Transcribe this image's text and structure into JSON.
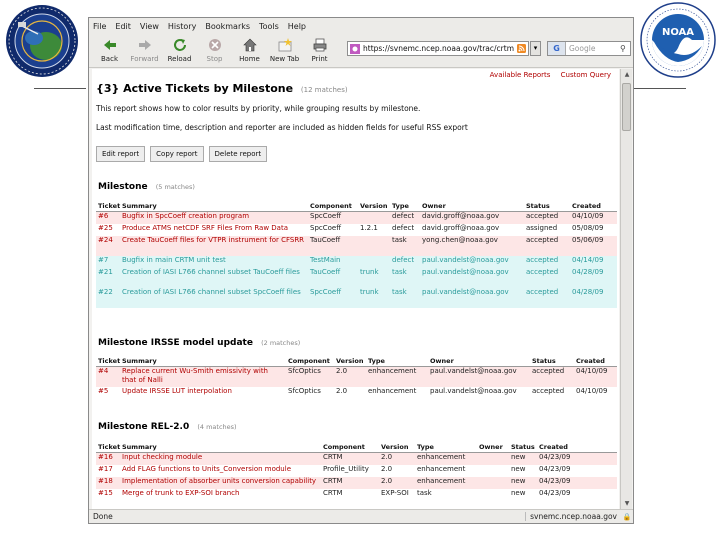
{
  "browser": {
    "menu": [
      "File",
      "Edit",
      "View",
      "History",
      "Bookmarks",
      "Tools",
      "Help"
    ],
    "toolbar": [
      {
        "label": "Back",
        "icon": "back-arrow-icon",
        "enabled": true
      },
      {
        "label": "Forward",
        "icon": "forward-arrow-icon",
        "enabled": false
      },
      {
        "label": "Reload",
        "icon": "reload-icon",
        "enabled": true
      },
      {
        "label": "Stop",
        "icon": "stop-icon",
        "enabled": false
      },
      {
        "label": "Home",
        "icon": "home-icon",
        "enabled": true
      },
      {
        "label": "New Tab",
        "icon": "new-tab-icon",
        "enabled": true
      },
      {
        "label": "Print",
        "icon": "print-icon",
        "enabled": true
      }
    ],
    "url": "https://svnemc.ncep.noaa.gov/trac/crtm",
    "search_placeholder": "Google",
    "status_text": "Done",
    "status_host": "svnemc.ncep.noaa.gov"
  },
  "page": {
    "nav": {
      "available_reports": "Available Reports",
      "custom_query": "Custom Query"
    },
    "title": "{3} Active Tickets by Milestone",
    "title_count": "(12 matches)",
    "description": "This report shows how to color results by priority, while grouping results by milestone.",
    "description2": "Last modification time, description and reporter are included as hidden fields for useful RSS export",
    "buttons": {
      "edit": "Edit report",
      "copy": "Copy report",
      "delete": "Delete report"
    }
  },
  "groups": [
    {
      "title": "Milestone",
      "count": "(5 matches)",
      "columns": [
        "Ticket",
        "Summary",
        "Component",
        "Version",
        "Type",
        "Owner",
        "Status",
        "Created"
      ],
      "rows": [
        {
          "ticket": "#6",
          "summary": "Bugfix in SpcCoeff creation program",
          "component": "SpcCoeff",
          "version": "",
          "type": "defect",
          "owner": "david.groff@noaa.gov",
          "status": "accepted",
          "created": "04/10/09",
          "color": "red"
        },
        {
          "ticket": "#25",
          "summary": "Produce ATMS netCDF SRF Files From Raw Data",
          "component": "SpcCoeff",
          "version": "1.2.1",
          "type": "defect",
          "owner": "david.groff@noaa.gov",
          "status": "assigned",
          "created": "05/08/09",
          "color": "white"
        },
        {
          "ticket": "#24",
          "summary": "Create TauCoeff files for VTPR instrument for CFSRR",
          "component": "TauCoeff",
          "version": "",
          "type": "task",
          "owner": "yong.chen@noaa.gov",
          "status": "accepted",
          "created": "05/06/09",
          "color": "red",
          "tall": true
        },
        {
          "ticket": "#7",
          "summary": "Bugfix in main CRTM unit test",
          "component": "TestMain",
          "version": "",
          "type": "defect",
          "owner": "paul.vandelst@noaa.gov",
          "status": "accepted",
          "created": "04/14/09",
          "color": "cyan"
        },
        {
          "ticket": "#21",
          "summary": "Creation of IASI L766 channel subset TauCoeff files",
          "component": "TauCoeff",
          "version": "trunk",
          "type": "task",
          "owner": "paul.vandelst@noaa.gov",
          "status": "accepted",
          "created": "04/28/09",
          "color": "cyan",
          "tall": true
        },
        {
          "ticket": "#22",
          "summary": "Creation of IASI L766 channel subset SpcCoeff files",
          "component": "SpcCoeff",
          "version": "trunk",
          "type": "task",
          "owner": "paul.vandelst@noaa.gov",
          "status": "accepted",
          "created": "04/28/09",
          "color": "cyan",
          "tall": true
        }
      ]
    },
    {
      "title": "Milestone IRSSE model update",
      "count": "(2 matches)",
      "columns": [
        "Ticket",
        "Summary",
        "Component",
        "Version",
        "Type",
        "Owner",
        "Status",
        "Created"
      ],
      "rows": [
        {
          "ticket": "#4",
          "summary": "Replace current Wu-Smith emissivity with that of Nalli",
          "component": "SfcOptics",
          "version": "2.0",
          "type": "enhancement",
          "owner": "paul.vandelst@noaa.gov",
          "status": "accepted",
          "created": "04/10/09",
          "color": "red",
          "tall": true
        },
        {
          "ticket": "#5",
          "summary": "Update IRSSE LUT interpolation",
          "component": "SfcOptics",
          "version": "2.0",
          "type": "enhancement",
          "owner": "paul.vandelst@noaa.gov",
          "status": "accepted",
          "created": "04/10/09",
          "color": "white"
        }
      ]
    },
    {
      "title": "Milestone REL-2.0",
      "count": "(4 matches)",
      "columns": [
        "Ticket",
        "Summary",
        "Component",
        "Version",
        "Type",
        "Owner",
        "Status",
        "Created"
      ],
      "rows": [
        {
          "ticket": "#16",
          "summary": "Input checking module",
          "component": "CRTM",
          "version": "2.0",
          "type": "enhancement",
          "owner": "",
          "status": "new",
          "created": "04/23/09",
          "color": "red"
        },
        {
          "ticket": "#17",
          "summary": "Add FLAG functions to Units_Conversion module",
          "component": "Profile_Utility",
          "version": "2.0",
          "type": "enhancement",
          "owner": "",
          "status": "new",
          "created": "04/23/09",
          "color": "white"
        },
        {
          "ticket": "#18",
          "summary": "Implementation of absorber units conversion capability",
          "component": "CRTM",
          "version": "2.0",
          "type": "enhancement",
          "owner": "",
          "status": "new",
          "created": "04/23/09",
          "color": "red"
        },
        {
          "ticket": "#15",
          "summary": "Merge of trunk to EXP-SOI branch",
          "component": "CRTM",
          "version": "EXP-SOI",
          "type": "task",
          "owner": "",
          "status": "new",
          "created": "04/23/09",
          "color": "white"
        }
      ]
    }
  ]
}
